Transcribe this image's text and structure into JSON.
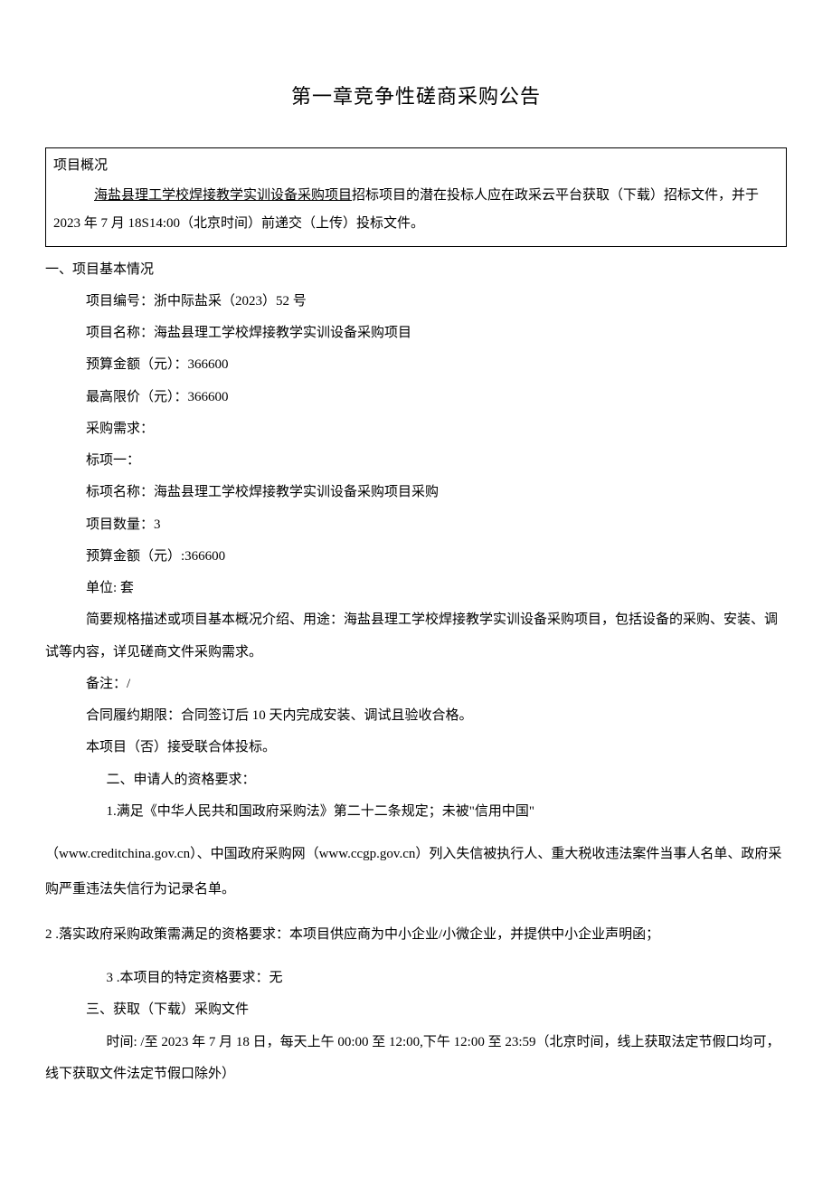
{
  "chapter_title": "第一章竞争性磋商采购公告",
  "overview": {
    "heading": "项目概况",
    "project_underlined": "海盐县理工学校焊接教学实训设备采购项目",
    "body_after_underline": "招标项目的潜在投标人应在政采云平台获取（下载）招标文件，并于 2023 年 7 月 18S14:00（北京时间）前递交（上传）投标文件。"
  },
  "section1": {
    "heading": "一、项目基本情况",
    "project_no": "项目编号：浙中际盐采（2023）52 号",
    "project_name": "项目名称：海盐县理工学校焊接教学实训设备采购项目",
    "budget": "预算金额（元）：366600",
    "ceiling": "最高限价（元）：366600",
    "req_label": "采购需求：",
    "lot_label": "标项一：",
    "lot_name": "标项名称：海盐县理工学校焊接教学实训设备采购项目采购",
    "lot_qty": "项目数量：3",
    "lot_budget": "预算金额（元）:366600",
    "lot_unit": "单位: 套",
    "lot_desc": "简要规格描述或项目基本概况介绍、用途：海盐县理工学校焊接教学实训设备采购项目，包括设备的采购、安装、调试等内容，详见磋商文件采购需求。",
    "remark": "备注：/",
    "contract_period": "合同履约期限：合同签订后 10 天内完成安装、调试且验收合格。",
    "consortium": "本项目（否）接受联合体投标。"
  },
  "section2": {
    "heading": "二、申请人的资格要求：",
    "req1_first": "1.满足《中华人民共和国政府采购法》第二十二条规定；未被\"信用中国\"",
    "req1_rest": "（www.creditchina.gov.cn）、中国政府采购网（www.ccgp.gov.cn）列入失信被执行人、重大税收违法案件当事人名单、政府采购严重违法失信行为记录名单。",
    "req2": "2 .落实政府采购政策需满足的资格要求：本项目供应商为中小企业/小微企业，并提供中小企业声明函；",
    "req3": "3 .本项目的特定资格要求：无"
  },
  "section3": {
    "heading": "三、获取（下载）采购文件",
    "time": "时间: /至 2023 年 7 月 18 日，每天上午 00:00 至 12:00,下午 12:00 至 23:59（北京时间，线上获取法定节假口均可，线下获取文件法定节假口除外）"
  }
}
